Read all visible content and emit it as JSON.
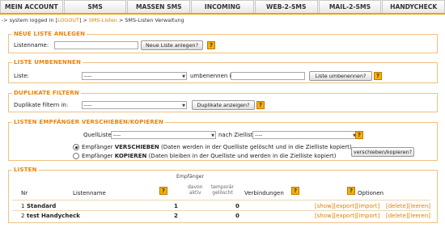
{
  "nav": {
    "tabs": [
      "MEIN ACCOUNT",
      "SMS",
      "MASSEN SMS",
      "INCOMING",
      "WEB-2-SMS",
      "MAIL-2-SMS",
      "HANDYCHECK"
    ]
  },
  "breadcrumb": {
    "prefix": "-> system logged in [",
    "logout": "LOGOUT",
    "mid": "] > ",
    "sms_listen": "SMS-Listen",
    "suffix": " > SMS-Listen Verwaltung"
  },
  "neue_liste": {
    "legend": "NEUE LISTE ANLEGEN",
    "label": "Listenname:",
    "input_value": "",
    "button": "Neue Liste anlegen?",
    "help": "?"
  },
  "umbenennen": {
    "legend": "LISTE UMBENENNEN",
    "label": "Liste:",
    "select_value": "----",
    "mid_label": "umbenennen in:",
    "input_value": "",
    "button": "Liste umbenennen?",
    "help": "?"
  },
  "duplikate": {
    "legend": "DUPLIKATE FILTERN",
    "label": "Duplikate filtern in:",
    "select_value": "----",
    "button": "Duplikate anzeigen?",
    "help": "?"
  },
  "verschieben": {
    "legend": "LISTEN EMPFÄNGER VERSCHIEBEN/KOPIEREN",
    "quell_label": "QuellListe:",
    "quell_value": "----",
    "ziel_label": "nach Zielliste:",
    "ziel_value": "----",
    "help": "?",
    "opt1_a": "Empfänger ",
    "opt1_b": "VERSCHIEBEN",
    "opt1_c": " (Daten werden in der Quelliste gelöscht und in die Zielliste kopiert)",
    "opt2_a": "Empfänger ",
    "opt2_b": "KOPIEREN",
    "opt2_c": " (Daten bleiben in der Quelliste und werden in die Zielliste kopiert)",
    "button": "verschieben/kopieren?"
  },
  "listen": {
    "legend": "LISTEN",
    "headers": {
      "nr": "Nr",
      "name": "Listenname",
      "empfaenger": "Empfänger",
      "aktiv_a": "davon",
      "aktiv_b": "aktiv",
      "geloescht_a": "temporär",
      "geloescht_b": "gelöscht",
      "verbindungen": "Verbindungen",
      "optionen": "Optionen",
      "help": "?"
    },
    "rows": [
      {
        "nr": "1",
        "name": "Standard",
        "aktiv": "1",
        "geloescht": "0",
        "links": "[show][export][import]",
        "links2": "[delete][leeren]"
      },
      {
        "nr": "2",
        "name": "test Handycheck",
        "aktiv": "2",
        "geloescht": "0",
        "links": "[show][export][import]",
        "links2": "[delete][leeren]"
      }
    ]
  },
  "colors": {
    "accent": "#f08000",
    "border": "#f0c080",
    "help_bg": "#f8b000"
  }
}
